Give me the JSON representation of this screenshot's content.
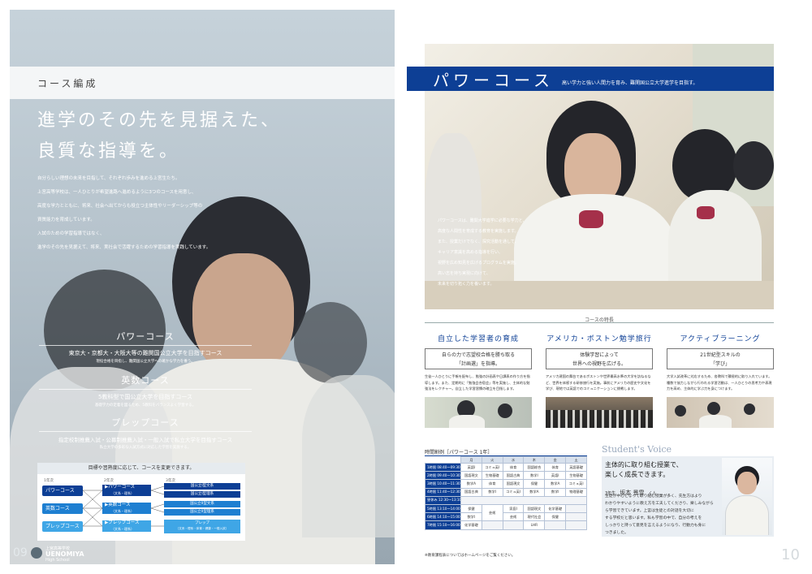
{
  "left_page": {
    "section_label": "コース編成",
    "headline": [
      "進学のその先を見据えた、",
      "良質な指導を。"
    ],
    "intro": [
      "自分らしい理想の未来を目指して、それぞれ歩みを進める上宮生たち。",
      "上宮高等学校は、一人ひとりが希望進路へ進めるように3つのコースを用意し、",
      "高度な学力とともに、将来、社会へ出てからも役立つ主体性やリーダーシップ等の",
      "資質能力を育成しています。",
      "入試のための学習指導ではなく、",
      "進学のその先を見据えて、将来、実社会で活躍するための学習指導を実践しています。"
    ],
    "courses": [
      {
        "title": "パワーコース",
        "main": "東京大・京都大・大阪大等の難関国公立大学を目指すコース",
        "sub": "現役合格を目指し、難関国公立大学への確かな学力を養う。"
      },
      {
        "title": "英数コース",
        "main": "5教科型で国公立大学を目指すコース",
        "sub": "基礎学力の定着を図るため、5教科をバランスよく学習する。"
      },
      {
        "title": "プレップコース",
        "main": "指定校制推薦入試・公募制推薦入試・一般入試で私立大学を目指すコース",
        "sub": "私立大学の多彩な入試方式に対応した学習を実施する。"
      }
    ],
    "change_panel": {
      "title": "目標や習熟度に応じて、コースを変更できます。",
      "year_labels": [
        "1年次",
        "2年次",
        "3年次"
      ],
      "year1": [
        "パワーコース",
        "英数コース",
        "プレップコース"
      ],
      "year2": [
        {
          "name": "▶パワーコース",
          "sub": "（文系・理系）"
        },
        {
          "name": "▶英数コース",
          "sub": "（文系・理系）"
        },
        {
          "name": "▶プレップコース",
          "sub": "（文系・理系）"
        }
      ],
      "year3": [
        "国公立I型文系",
        "国公立I型理系",
        "国公立II型文系",
        "国公立II型理系",
        "プレップ",
        "（文系・理系・体育・健康・一般入試）"
      ]
    },
    "page_number": "09",
    "school": {
      "jp": "上宮高等学校",
      "en": "UENOMIYA",
      "sub": "High School"
    }
  },
  "right_page": {
    "course_title": "パワーコース",
    "course_subtitle": "高い学力と強い人間力を育み、難関国公立大学進学を目指す。",
    "overlay_text": [
      "パワーコースは、難関大学進学に必要な学力と、",
      "高度な人間性を育成する教育を実施します。",
      "また、授業だけでなく、探究活動を通して、",
      "キャリア意識を高める指導を行い、",
      "視野を広め知見を広げるプログラムを実施。",
      "高い志を持ち実現に向けて、",
      "未来を切り拓く力を養います。"
    ],
    "features_label": "コースの特長",
    "features": [
      {
        "title": "自立した学習者の育成",
        "box": [
          "自らの力で志望校合格を勝ち取る",
          "「計画選」を指導。"
        ],
        "text": "生徒一人ひとりに手帳を配布し、勉強の計画表や日課表の作り方を指導します。また、定期的に「勉強会合宿会」等を実施し、主体的な勉強法をレクチャー。自立した学習習慣の確立を目指します。"
      },
      {
        "title": "アメリカ・ボストン勉学旅行",
        "box": [
          "体験学習によって",
          "世界への視野を広げる。"
        ],
        "text": "アメリカ建国の舞台であるボストンや世界最高水準の大学を訪ねるなど、世界を体感する研修旅行を実施。事前にアメリカの歴史や文化を学び、現地では英語でのコミュニケーションに挑戦します。"
      },
      {
        "title": "アクティブラーニング",
        "box": [
          "21世紀型スキルの",
          "「学び」"
        ],
        "text": "大学入試改革に対応するため、各教科で積極的に取り入れています。種数で協力しながら行われる学習活動は、一人ひとりの思考力や表現力を高め、主体的に学ぶ力を身につけます。"
      }
    ],
    "timetable": {
      "title": "時間割例［パワーコース 1年］",
      "days": [
        "月",
        "火",
        "水",
        "木",
        "金",
        "土"
      ],
      "rows": [
        {
          "period": "1時限 08:40〜09:30",
          "cells": [
            "英語I",
            "コミュ英I",
            "体育",
            "国語総合",
            "体育",
            "英語基礎"
          ],
          "span": null
        },
        {
          "period": "2時限 09:40〜10:30",
          "cells": [
            "国語現文",
            "生物基礎",
            "国語古典",
            "数学I",
            "英語I",
            "生物基礎"
          ],
          "span": null
        },
        {
          "period": "3時限 10:40〜11:30",
          "cells": [
            "数学A",
            "体育",
            "国語現文",
            "保健",
            "数学A",
            "コミュ英I"
          ],
          "span": null
        },
        {
          "period": "4時限 11:40〜12:30",
          "cells": [
            "国語古典",
            "数学I",
            "コミュ英I",
            "数学A",
            "数学I",
            "物理基礎"
          ],
          "span": null
        },
        {
          "period": "昼休み 12:30〜13:10",
          "cells": [
            "",
            "",
            "",
            "",
            "",
            ""
          ],
          "span": null
        },
        {
          "period": "5時限 13:10〜14:00",
          "cells": [
            "保健",
            "",
            "家庭I",
            "国語現文",
            "化学基礎",
            ""
          ],
          "span": "芸術"
        },
        {
          "period": "6時限 14:10〜15:00",
          "cells": [
            "数学I",
            "",
            "芸術",
            "現代社会",
            "保健",
            ""
          ],
          "span": null
        },
        {
          "period": "7時限 15:10〜16:00",
          "cells": [
            "化学基礎",
            "",
            "",
            "LHR",
            "",
            ""
          ],
          "span": null
        }
      ],
      "note": "※教育課程表についてはホームページをご覧ください。"
    },
    "student_voice": {
      "title": "Student's Voice",
      "headline": [
        "主体的に取り組む授業で、",
        "楽しく成長できます。"
      ],
      "grade": "3年生",
      "name": "坂本 景雪",
      "honorific": "くん",
      "text": [
        "生徒が中心となって取り組む授業が多く、先生方はより",
        "わかりやすいように教え方を工夫してくださり、楽しみながら",
        "ら学習できています。上宮は生徒との対話を大切に",
        "する学校だと思います。私も学習の中で、自分の考えを",
        "しっかりと持って意見を言えるようになり、行動力も身に",
        "つきました。"
      ]
    },
    "page_number": "10"
  },
  "colors": {
    "brand_blue": "#0d3f95",
    "light_blue": "#1e7fd1",
    "photo_gray": "#b7c4cd"
  }
}
